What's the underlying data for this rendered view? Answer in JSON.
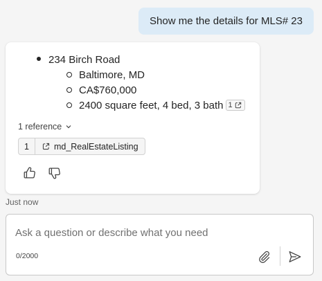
{
  "user_message": "Show me the details for MLS# 23",
  "response": {
    "address": "234 Birch Road",
    "details": [
      "Baltimore, MD",
      "CA$760,000",
      "2400 square feet, 4 bed, 3 bath"
    ],
    "citation_number": "1",
    "references_toggle": "1 reference",
    "reference": {
      "number": "1",
      "name": "md_RealEstateListing"
    }
  },
  "timestamp": "Just now",
  "composer": {
    "placeholder": "Ask a question or describe what you need",
    "counter": "0/2000"
  },
  "icons": {
    "thumbs_up": "thumbs-up-icon",
    "thumbs_down": "thumbs-down-icon",
    "external_link": "open-link-icon",
    "chevron": "chevron-down-icon",
    "attach": "paperclip-icon",
    "send": "send-icon"
  },
  "colors": {
    "user_bubble": "#dcebf7",
    "card_background": "#ffffff",
    "page_background": "#f5f5f5"
  }
}
